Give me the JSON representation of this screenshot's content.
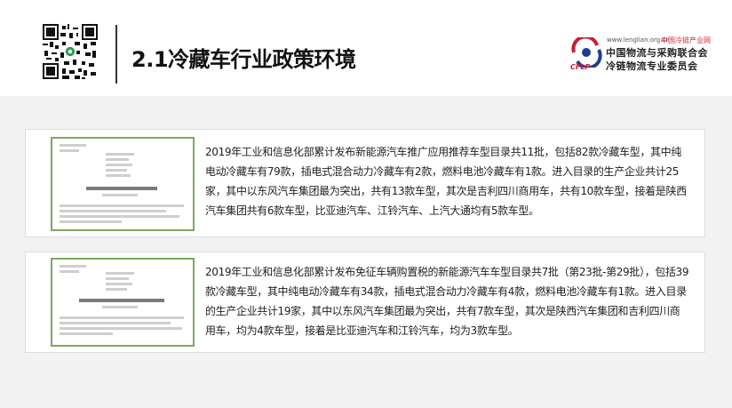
{
  "header": {
    "title": "2.1冷藏车行业政策环境"
  },
  "org": {
    "url": "www.lenglian.org.cn",
    "tagline": "中国冷链产业网",
    "name_line1": "中国物流与采购联合会",
    "name_line2": "冷链物流专业委员会",
    "logo_text": "CFLP",
    "brand_colors": {
      "red": "#c81e39",
      "navy": "#1f3e8c"
    }
  },
  "section1": {
    "paragraph": "2019年工业和信息化部累计发布新能源汽车推广应用推荐车型目录共11批，包括82款冷藏车型，其中纯电动冷藏车有79款，插电式混合动力冷藏车有2款，燃料电池冷藏车有1款。进入目录的生产企业共计25家，其中以东风汽车集团最为突出，共有13款车型，其次是吉利四川商用车，共有10款车型，接着是陕西汽车集团共有6款车型，比亚迪汽车、江铃汽车、上汽大通均有5款车型。"
  },
  "section2": {
    "paragraph": "2019年工业和信息化部累计发布免征车辆购置税的新能源汽车车型目录共7批（第23批-第29批），包括39款冷藏车型，其中纯电动冷藏车有34款，插电式混合动力冷藏车有4款，燃料电池冷藏车有1款。进入目录的生产企业共计19家，其中以东风汽车集团最为突出，共有7款车型，其次是陕西汽车集团和吉利四川商用车，均为4款车型，接着是比亚迪汽车和江铃汽车，均为3款车型。"
  }
}
